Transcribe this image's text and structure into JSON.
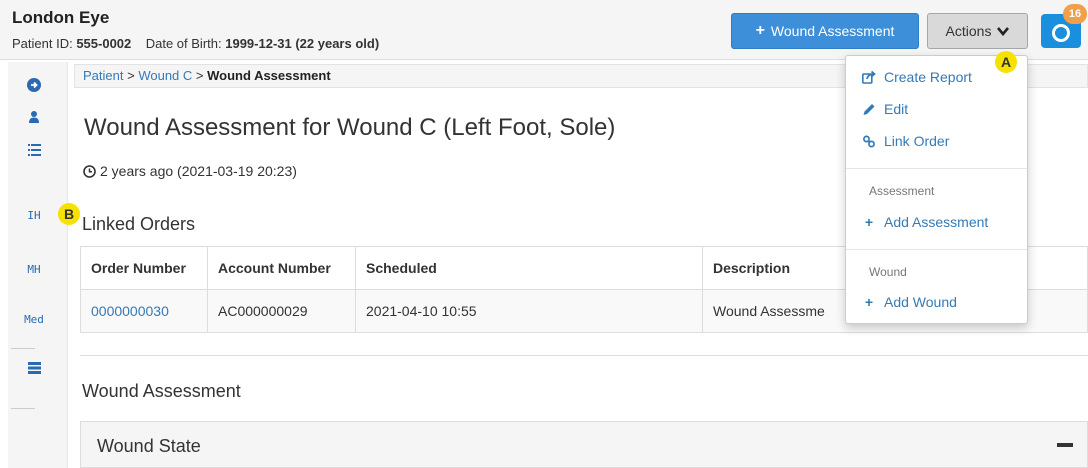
{
  "header": {
    "patient_name": "London Eye",
    "patient_id_label": "Patient ID:",
    "patient_id": "555-0002",
    "dob_label": "Date of Birth:",
    "dob": "1999-12-31 (22 years old)",
    "wound_assessment_button": "Wound Assessment",
    "actions_button": "Actions",
    "camera_badge": "16"
  },
  "sidebar": {
    "items": [
      {
        "icon": "arrow-circle-right-icon",
        "glyph": "➔"
      },
      {
        "icon": "user-icon",
        "glyph": "person"
      },
      {
        "icon": "list-icon",
        "glyph": "≣"
      },
      {
        "icon": "ih-icon",
        "label": "IH"
      },
      {
        "icon": "mh-icon",
        "label": "MH"
      },
      {
        "icon": "med-icon",
        "label": "Med"
      },
      {
        "icon": "tasks-icon",
        "glyph": "▤"
      }
    ]
  },
  "breadcrumb": {
    "patient": "Patient",
    "separator": ">",
    "wound": "Wound C",
    "current": "Wound Assessment"
  },
  "main": {
    "title": "Wound Assessment for Wound C (Left Foot, Sole)",
    "time": "2 years ago (2021-03-19 20:23)",
    "linked_orders_title": "Linked Orders",
    "table": {
      "headers": [
        "Order Number",
        "Account Number",
        "Scheduled",
        "Description"
      ],
      "rows": [
        [
          "0000000030",
          "AC000000029",
          "2021-04-10 10:55",
          "Wound Assessme"
        ]
      ]
    },
    "wound_assessment_title": "Wound Assessment",
    "wound_state_title": "Wound State"
  },
  "menu": {
    "create_report": "Create Report",
    "edit": "Edit",
    "link_order": "Link Order",
    "assessment_header": "Assessment",
    "add_assessment": "Add Assessment",
    "wound_header": "Wound",
    "add_wound": "Add Wound"
  },
  "markers": {
    "a": "A",
    "b": "B"
  },
  "colors": {
    "primary": "#3c8fd8",
    "link": "#337ab7",
    "badge": "#f0a04b",
    "marker": "#f6e200"
  }
}
